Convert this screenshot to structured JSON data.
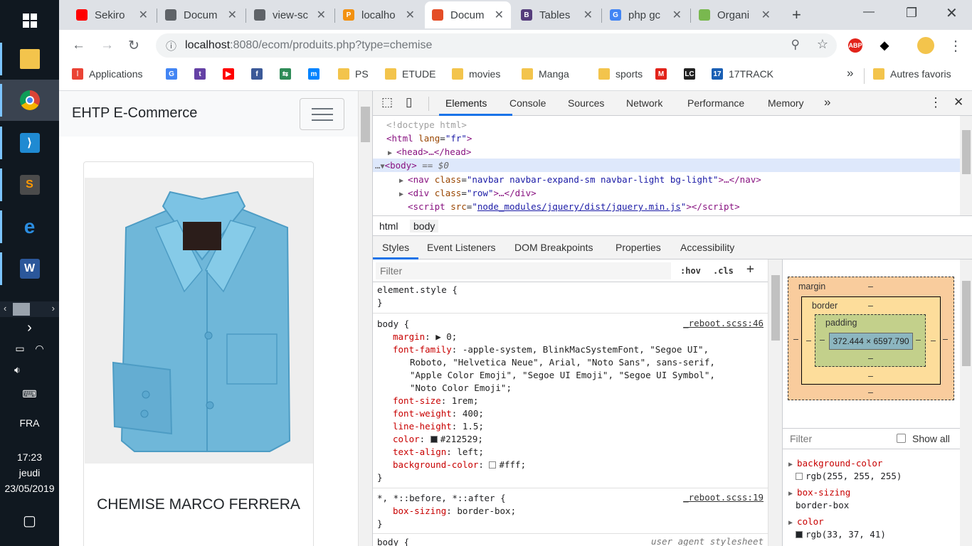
{
  "taskbar": {
    "apps": [
      {
        "name": "start",
        "label": ""
      },
      {
        "name": "file-explorer",
        "label": ""
      },
      {
        "name": "chrome",
        "label": ""
      },
      {
        "name": "vscode",
        "label": ""
      },
      {
        "name": "sublime",
        "label": "S"
      },
      {
        "name": "edge",
        "label": "e"
      },
      {
        "name": "word",
        "label": "W"
      }
    ],
    "language": "FRA",
    "time": "17:23",
    "day": "jeudi",
    "date": "23/05/2019"
  },
  "browser": {
    "tabs": [
      {
        "title": "Sekiro",
        "favicon_color": "#ff0000"
      },
      {
        "title": "Docum",
        "favicon_color": "#5f6368"
      },
      {
        "title": "view-sc",
        "favicon_color": "#5f6368"
      },
      {
        "title": "localho",
        "favicon_text": "PMA",
        "favicon_color": "#f29111"
      },
      {
        "title": "Docum",
        "favicon_color": "#e44d26"
      },
      {
        "title": "Tables",
        "favicon_text": "B",
        "favicon_color": "#563d7c"
      },
      {
        "title": "php gc",
        "favicon_text": "G",
        "favicon_color": "#4285f4"
      },
      {
        "title": "Organi",
        "favicon_color": "#79b84f"
      }
    ],
    "active_tab_index": 4,
    "url_host": "localhost",
    "url_path": ":8080/ecom/produits.php?type=chemise",
    "bookmarks": [
      {
        "label": "Applications",
        "icon": "apps-grid-icon"
      },
      {
        "label": "",
        "icon": "google-icon"
      },
      {
        "label": "",
        "icon": "twitch-icon"
      },
      {
        "label": "",
        "icon": "youtube-icon"
      },
      {
        "label": "",
        "icon": "facebook-icon"
      },
      {
        "label": "",
        "icon": "sync-icon"
      },
      {
        "label": "",
        "icon": "messenger-icon"
      },
      {
        "label": "PS",
        "icon": "folder-icon"
      },
      {
        "label": "ETUDE",
        "icon": "folder-icon"
      },
      {
        "label": "movies",
        "icon": "folder-icon"
      },
      {
        "label": "Manga",
        "icon": "folder-icon"
      },
      {
        "label": "sports",
        "icon": "folder-icon"
      },
      {
        "label": "",
        "icon": "m-icon"
      },
      {
        "label": "",
        "icon": "lc-icon"
      },
      {
        "label": "17TRACK",
        "icon": "17track-icon"
      }
    ],
    "more_bookmarks": "»",
    "other_bookmarks": "Autres favoris",
    "extensions": {
      "abp": "ABP"
    }
  },
  "page": {
    "brand": "EHTP E-Commerce",
    "product_name": "CHEMISE MARCO FERRERA"
  },
  "devtools": {
    "tabs": [
      "Elements",
      "Console",
      "Sources",
      "Network",
      "Performance",
      "Memory"
    ],
    "more_tabs": "»",
    "dom": {
      "doctype": "<!doctype html>",
      "html_open": "<html",
      "html_attr": "lang",
      "html_val": "\"fr\"",
      "head": "<head>…</head>",
      "body": "<body>",
      "body_suffix": "== $0",
      "nav_class": "\"navbar navbar-expand-sm navbar-light bg-light\"",
      "div_class": "\"row\"",
      "script_src": "node_modules/jquery/dist/jquery.min.js"
    },
    "breadcrumbs": [
      "html",
      "body"
    ],
    "sub_tabs": [
      "Styles",
      "Event Listeners",
      "DOM Breakpoints",
      "Properties",
      "Accessibility"
    ],
    "filter_placeholder": "Filter",
    "hov": ":hov",
    "cls": ".cls",
    "add": "+",
    "styles": {
      "element_style": "element.style {",
      "close": "}",
      "body_selector": "body {",
      "body_source": "_reboot.scss:46",
      "body_props": [
        {
          "name": "margin",
          "value": "▶ 0;"
        },
        {
          "name": "font-family",
          "value": "-apple-system, BlinkMacSystemFont, \"Segoe UI\","
        },
        {
          "name": "",
          "value": "Roboto, \"Helvetica Neue\", Arial, \"Noto Sans\", sans-serif,"
        },
        {
          "name": "",
          "value": "\"Apple Color Emoji\", \"Segoe UI Emoji\", \"Segoe UI Symbol\","
        },
        {
          "name": "",
          "value": "\"Noto Color Emoji\";"
        },
        {
          "name": "font-size",
          "value": "1rem;"
        },
        {
          "name": "font-weight",
          "value": "400;"
        },
        {
          "name": "line-height",
          "value": "1.5;"
        },
        {
          "name": "color",
          "value": "#212529;",
          "swatch": "#212529"
        },
        {
          "name": "text-align",
          "value": "left;"
        },
        {
          "name": "background-color",
          "value": "#fff;",
          "swatch": "#ffffff"
        }
      ],
      "star_selector": "*, *::before, *::after {",
      "star_source": "_reboot.scss:19",
      "star_prop": "box-sizing",
      "star_value": "border-box;",
      "next_selector": "body {",
      "next_source": "user agent stylesheet"
    },
    "box_model": {
      "margin": "margin",
      "border": "border",
      "padding": "padding",
      "dash": "–",
      "content": "372.444 × 6597.790"
    },
    "computed": {
      "filter_placeholder": "Filter",
      "show_all": "Show all",
      "props": [
        {
          "name": "background-color",
          "value": "rgb(255, 255, 255)",
          "swatch": "#ffffff"
        },
        {
          "name": "box-sizing",
          "value": "border-box"
        },
        {
          "name": "color",
          "value": "rgb(33, 37, 41)",
          "swatch": "#212529"
        }
      ]
    }
  }
}
